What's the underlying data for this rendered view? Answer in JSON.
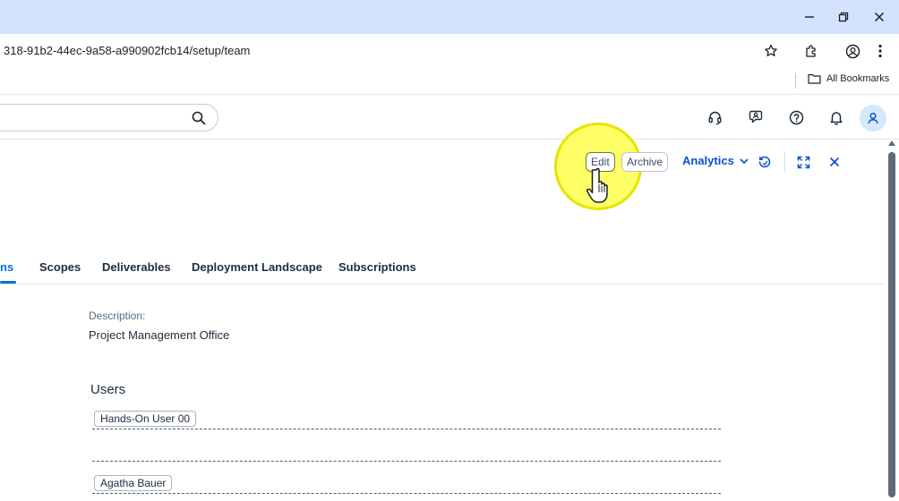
{
  "browser": {
    "url_fragment": "318-91b2-44ec-9a58-a990902fcb14/setup/team",
    "bookmarks_label": "All Bookmarks"
  },
  "shell": {
    "search_placeholder": "",
    "icons": [
      "headset-icon",
      "feedback-icon",
      "help-icon",
      "notifications-icon",
      "user-icon"
    ]
  },
  "header_actions": {
    "edit_label": "Edit",
    "archive_label": "Archive",
    "analytics_label": "Analytics"
  },
  "tabs": [
    {
      "label": "ns",
      "active": true
    },
    {
      "label": "Scopes",
      "active": false
    },
    {
      "label": "Deliverables",
      "active": false
    },
    {
      "label": "Deployment Landscape",
      "active": false
    },
    {
      "label": "Subscriptions",
      "active": false
    }
  ],
  "details": {
    "description_label": "Description:",
    "description_value": "Project Management Office",
    "users_title": "Users",
    "users": [
      "Hands-On User 00",
      "Agatha Bauer"
    ]
  },
  "colors": {
    "titlebar": "#d3e3fd",
    "accent": "#0a6ed1",
    "highlight": "#ffff3c"
  }
}
